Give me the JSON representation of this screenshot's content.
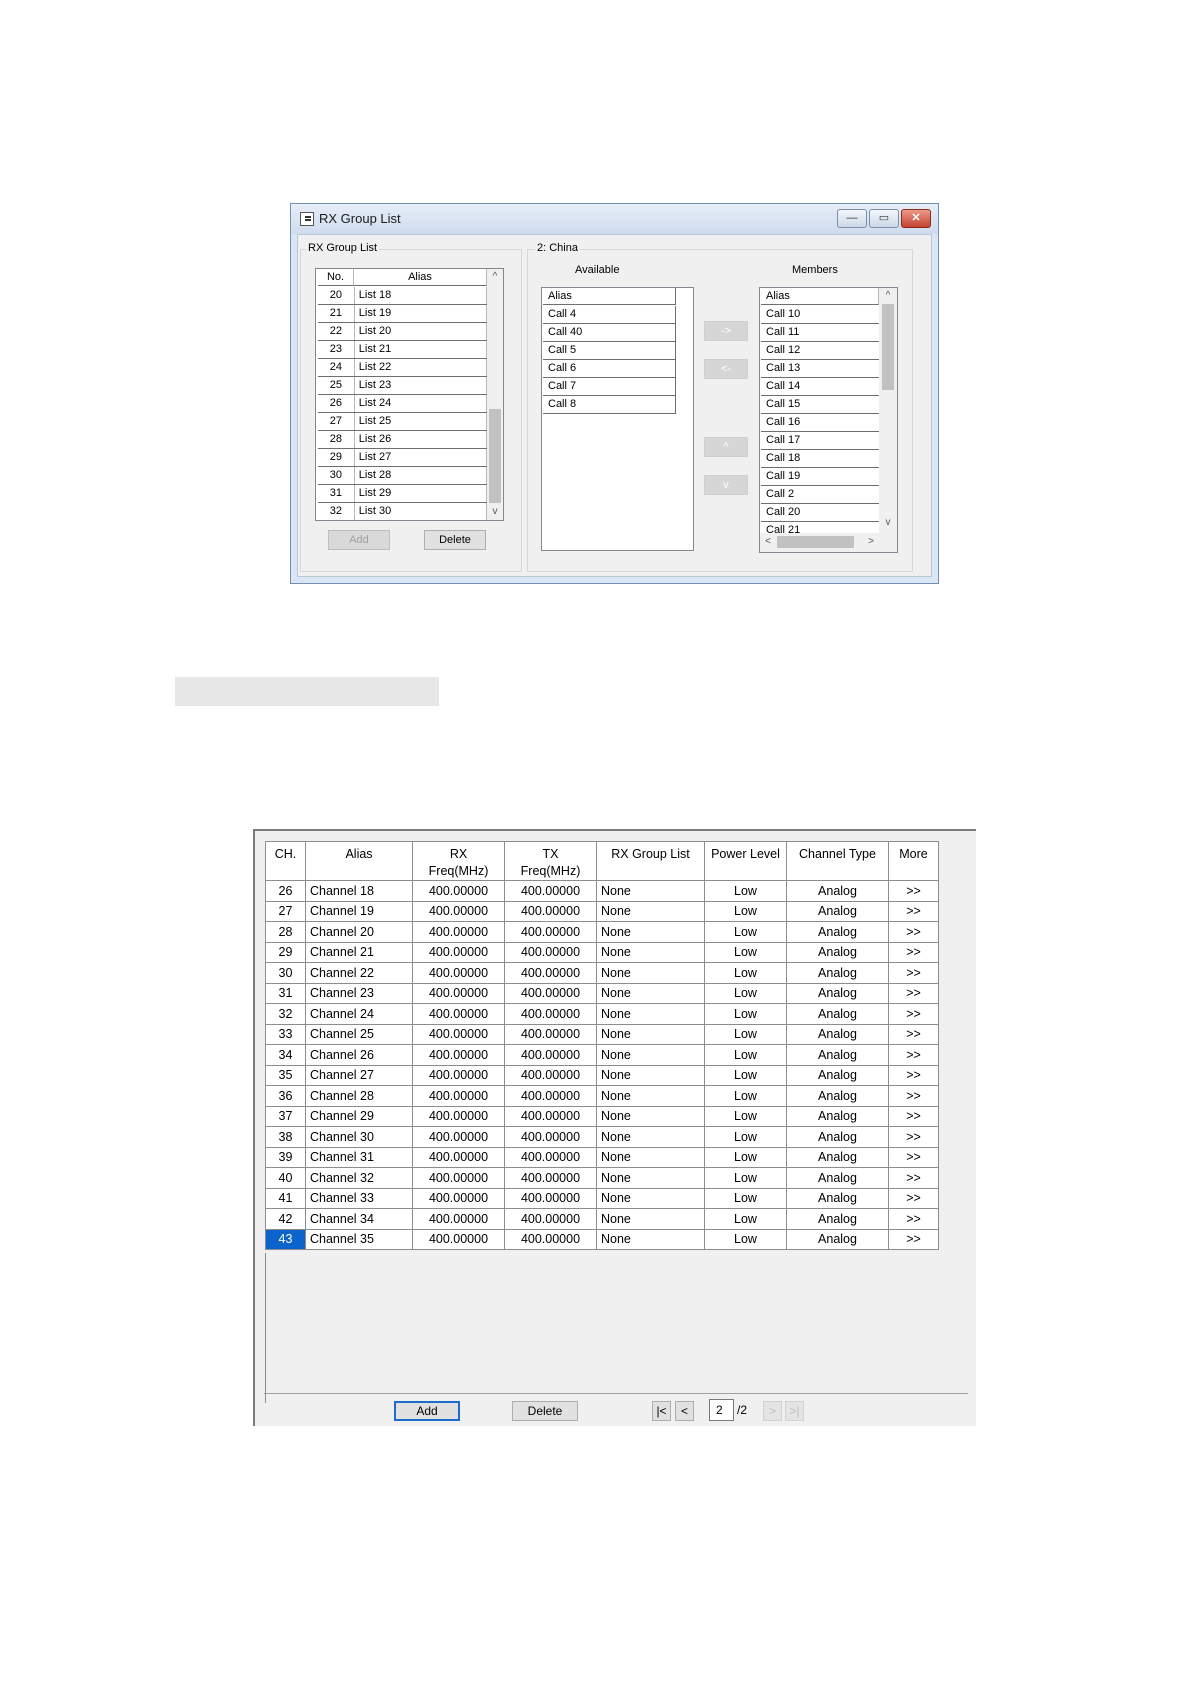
{
  "rx_window": {
    "title": "RX Group List",
    "caption_buttons": {
      "minimize": "—",
      "maximize": "▭",
      "close": "✕"
    },
    "left_group": {
      "label": "RX Group List",
      "columns": [
        "No.",
        "Alias"
      ],
      "rows": [
        {
          "no": "20",
          "alias": "List 18"
        },
        {
          "no": "21",
          "alias": "List 19"
        },
        {
          "no": "22",
          "alias": "List 20"
        },
        {
          "no": "23",
          "alias": "List 21"
        },
        {
          "no": "24",
          "alias": "List 22"
        },
        {
          "no": "25",
          "alias": "List 23"
        },
        {
          "no": "26",
          "alias": "List 24"
        },
        {
          "no": "27",
          "alias": "List 25"
        },
        {
          "no": "28",
          "alias": "List 26"
        },
        {
          "no": "29",
          "alias": "List 27"
        },
        {
          "no": "30",
          "alias": "List 28"
        },
        {
          "no": "31",
          "alias": "List 29"
        },
        {
          "no": "32",
          "alias": "List 30"
        }
      ],
      "add_label": "Add",
      "delete_label": "Delete"
    },
    "right_group": {
      "label": "2: China",
      "available_label": "Available",
      "members_label": "Members",
      "available_header": "Alias",
      "available": [
        "Call 4",
        "Call 40",
        "Call 5",
        "Call 6",
        "Call 7",
        "Call 8"
      ],
      "members_header": "Alias",
      "members": [
        "Call 10",
        "Call 11",
        "Call 12",
        "Call 13",
        "Call 14",
        "Call 15",
        "Call 16",
        "Call 17",
        "Call 18",
        "Call 19",
        "Call 2",
        "Call 20",
        "Call 21"
      ],
      "move_buttons": {
        "add": "->",
        "remove": "<-",
        "up": "^",
        "down": "v"
      },
      "scroll_arrows": {
        "up": "^",
        "down": "v",
        "left": "<",
        "right": ">"
      }
    }
  },
  "channel_table": {
    "columns": [
      {
        "line1": "CH.",
        "line2": ""
      },
      {
        "line1": "Alias",
        "line2": ""
      },
      {
        "line1": "RX",
        "line2": "Freq(MHz)"
      },
      {
        "line1": "TX",
        "line2": "Freq(MHz)"
      },
      {
        "line1": "RX Group List",
        "line2": ""
      },
      {
        "line1": "Power Level",
        "line2": ""
      },
      {
        "line1": "Channel Type",
        "line2": ""
      },
      {
        "line1": "More",
        "line2": ""
      }
    ],
    "rows": [
      {
        "ch": "26",
        "alias": "Channel 18",
        "rx": "400.00000",
        "tx": "400.00000",
        "group": "None",
        "power": "Low",
        "type": "Analog",
        "more": ">>"
      },
      {
        "ch": "27",
        "alias": "Channel 19",
        "rx": "400.00000",
        "tx": "400.00000",
        "group": "None",
        "power": "Low",
        "type": "Analog",
        "more": ">>"
      },
      {
        "ch": "28",
        "alias": "Channel 20",
        "rx": "400.00000",
        "tx": "400.00000",
        "group": "None",
        "power": "Low",
        "type": "Analog",
        "more": ">>"
      },
      {
        "ch": "29",
        "alias": "Channel 21",
        "rx": "400.00000",
        "tx": "400.00000",
        "group": "None",
        "power": "Low",
        "type": "Analog",
        "more": ">>"
      },
      {
        "ch": "30",
        "alias": "Channel 22",
        "rx": "400.00000",
        "tx": "400.00000",
        "group": "None",
        "power": "Low",
        "type": "Analog",
        "more": ">>"
      },
      {
        "ch": "31",
        "alias": "Channel 23",
        "rx": "400.00000",
        "tx": "400.00000",
        "group": "None",
        "power": "Low",
        "type": "Analog",
        "more": ">>"
      },
      {
        "ch": "32",
        "alias": "Channel 24",
        "rx": "400.00000",
        "tx": "400.00000",
        "group": "None",
        "power": "Low",
        "type": "Analog",
        "more": ">>"
      },
      {
        "ch": "33",
        "alias": "Channel 25",
        "rx": "400.00000",
        "tx": "400.00000",
        "group": "None",
        "power": "Low",
        "type": "Analog",
        "more": ">>"
      },
      {
        "ch": "34",
        "alias": "Channel 26",
        "rx": "400.00000",
        "tx": "400.00000",
        "group": "None",
        "power": "Low",
        "type": "Analog",
        "more": ">>"
      },
      {
        "ch": "35",
        "alias": "Channel 27",
        "rx": "400.00000",
        "tx": "400.00000",
        "group": "None",
        "power": "Low",
        "type": "Analog",
        "more": ">>"
      },
      {
        "ch": "36",
        "alias": "Channel 28",
        "rx": "400.00000",
        "tx": "400.00000",
        "group": "None",
        "power": "Low",
        "type": "Analog",
        "more": ">>"
      },
      {
        "ch": "37",
        "alias": "Channel 29",
        "rx": "400.00000",
        "tx": "400.00000",
        "group": "None",
        "power": "Low",
        "type": "Analog",
        "more": ">>"
      },
      {
        "ch": "38",
        "alias": "Channel 30",
        "rx": "400.00000",
        "tx": "400.00000",
        "group": "None",
        "power": "Low",
        "type": "Analog",
        "more": ">>"
      },
      {
        "ch": "39",
        "alias": "Channel 31",
        "rx": "400.00000",
        "tx": "400.00000",
        "group": "None",
        "power": "Low",
        "type": "Analog",
        "more": ">>"
      },
      {
        "ch": "40",
        "alias": "Channel 32",
        "rx": "400.00000",
        "tx": "400.00000",
        "group": "None",
        "power": "Low",
        "type": "Analog",
        "more": ">>"
      },
      {
        "ch": "41",
        "alias": "Channel 33",
        "rx": "400.00000",
        "tx": "400.00000",
        "group": "None",
        "power": "Low",
        "type": "Analog",
        "more": ">>"
      },
      {
        "ch": "42",
        "alias": "Channel 34",
        "rx": "400.00000",
        "tx": "400.00000",
        "group": "None",
        "power": "Low",
        "type": "Analog",
        "more": ">>"
      },
      {
        "ch": "43",
        "alias": "Channel 35",
        "rx": "400.00000",
        "tx": "400.00000",
        "group": "None",
        "power": "Low",
        "type": "Analog",
        "more": ">>"
      }
    ],
    "selected_ch": "43",
    "selection_color": "#0a64cc",
    "add_label": "Add",
    "delete_label": "Delete",
    "pager": {
      "first": "|<",
      "prev": "<",
      "page": "2",
      "total": "/2",
      "next": ">",
      "last": ">|"
    }
  }
}
